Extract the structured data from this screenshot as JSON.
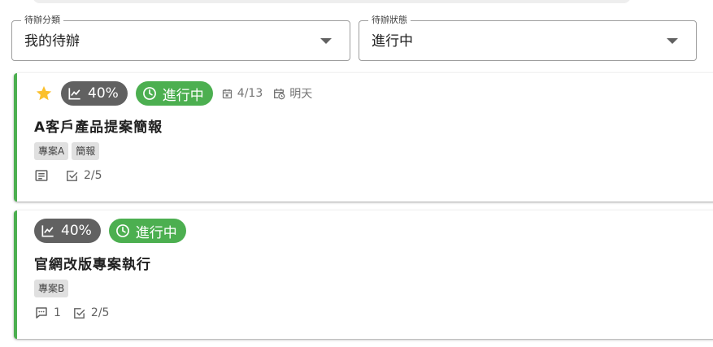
{
  "filters": {
    "category": {
      "label": "待辦分類",
      "value": "我的待辦"
    },
    "status": {
      "label": "待辦狀態",
      "value": "進行中"
    }
  },
  "colors": {
    "accent": "#4caf50",
    "progress_chip": "#616161",
    "star": "#fbc02d"
  },
  "todos": [
    {
      "starred": true,
      "progress": "40%",
      "status": "進行中",
      "start_date": "4/13",
      "due": "明天",
      "title": "A客戶產品提案簡報",
      "tags": [
        "專案A",
        "簡報"
      ],
      "checklist": "2/5",
      "has_description": true,
      "icons": [
        "star-icon",
        "trend-icon",
        "clock-icon",
        "calendar-icon",
        "calendar-clock-icon",
        "notes-icon",
        "checkbox-icon"
      ]
    },
    {
      "starred": false,
      "progress": "40%",
      "status": "進行中",
      "title": "官網改版專案執行",
      "tags": [
        "專案B"
      ],
      "comments": "1",
      "checklist": "2/5",
      "icons": [
        "trend-icon",
        "clock-icon",
        "comment-icon",
        "checkbox-icon"
      ]
    }
  ]
}
